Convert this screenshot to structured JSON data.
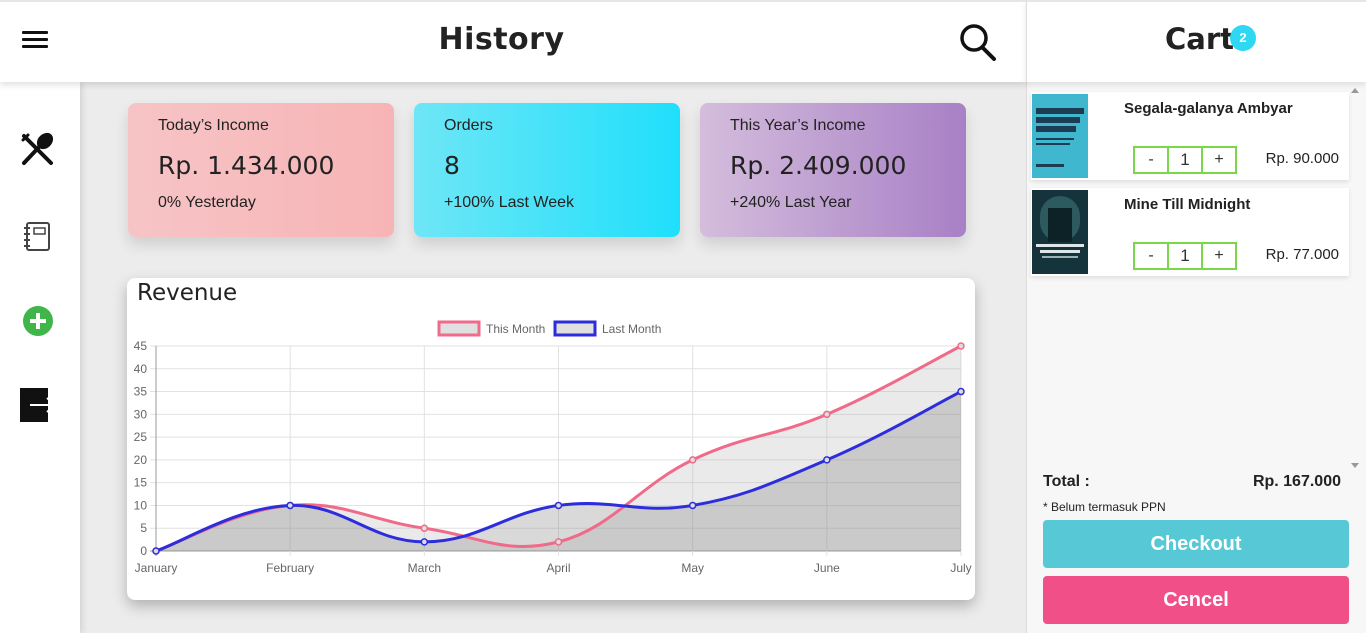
{
  "header": {
    "title": "History",
    "menu_icon": "hamburger-menu-icon",
    "search_icon": "magnifier-icon"
  },
  "sidebar": {
    "items": [
      {
        "icon": "fork-spoon-icon"
      },
      {
        "icon": "notebook-icon"
      },
      {
        "icon": "add-circle-icon",
        "color": "#3fb54a"
      },
      {
        "icon": "logout-icon"
      }
    ]
  },
  "stats": [
    {
      "label": "Today’s Income",
      "value": "Rp. 1.434.000",
      "sub": "0% Yesterday"
    },
    {
      "label": "Orders",
      "value": "8",
      "sub": "+100% Last Week"
    },
    {
      "label": "This Year’s Income",
      "value": "Rp. 2.409.000",
      "sub": "+240% Last Year"
    }
  ],
  "chart_data": {
    "type": "line",
    "title": "Revenue",
    "categories": [
      "January",
      "February",
      "March",
      "April",
      "May",
      "June",
      "July"
    ],
    "series": [
      {
        "name": "This Month",
        "values": [
          0,
          10,
          5,
          2,
          20,
          30,
          45
        ],
        "color": "#f06a8a"
      },
      {
        "name": "Last Month",
        "values": [
          0,
          10,
          2,
          10,
          10,
          20,
          35
        ],
        "color": "#2d2ddb"
      }
    ],
    "ylim": [
      0,
      45
    ],
    "yticks": [
      0,
      5,
      10,
      15,
      20,
      25,
      30,
      35,
      40,
      45
    ],
    "grid": true,
    "legend": "top-center"
  },
  "cart": {
    "title": "Cart",
    "badge": "2",
    "items": [
      {
        "name": "Segala-galanya Ambyar",
        "qty": "1",
        "price": "Rp. 90.000",
        "minus": "-",
        "plus": "+"
      },
      {
        "name": "Mine Till Midnight",
        "qty": "1",
        "price": "Rp. 77.000",
        "minus": "-",
        "plus": "+"
      }
    ],
    "total_label": "Total :",
    "total_value": "Rp. 167.000",
    "note": "* Belum termasuk PPN",
    "checkout_label": "Checkout",
    "cancel_label": "Cencel"
  },
  "colors": {
    "accent_cyan": "#2fd8f2",
    "checkout": "#57c8d6",
    "cancel": "#f14f87",
    "stepper_border": "#7ad64a"
  }
}
